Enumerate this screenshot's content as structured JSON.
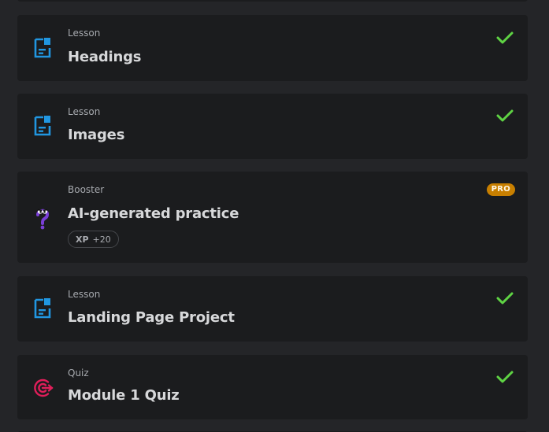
{
  "colors": {
    "background": "#242528",
    "card": "#1b1c1e",
    "lesson_icon": "#2196e0",
    "check": "#5fd344",
    "pro_badge": "#c87f00",
    "quiz_icon": "#e01e5a",
    "booster_icon": "#7a3fd6"
  },
  "items": [
    {
      "kind": "Lesson",
      "title": "Headings",
      "icon": "lesson-doc-icon",
      "completed": true
    },
    {
      "kind": "Lesson",
      "title": "Images",
      "icon": "lesson-doc-icon",
      "completed": true
    },
    {
      "kind": "Booster",
      "title": "AI-generated practice",
      "icon": "booster-question-icon",
      "completed": false,
      "badge": "PRO",
      "xp_label": "XP",
      "xp_value": "+20"
    },
    {
      "kind": "Lesson",
      "title": "Landing Page Project",
      "icon": "lesson-doc-icon",
      "completed": true
    },
    {
      "kind": "Quiz",
      "title": "Module 1 Quiz",
      "icon": "quiz-target-icon",
      "completed": true
    }
  ]
}
